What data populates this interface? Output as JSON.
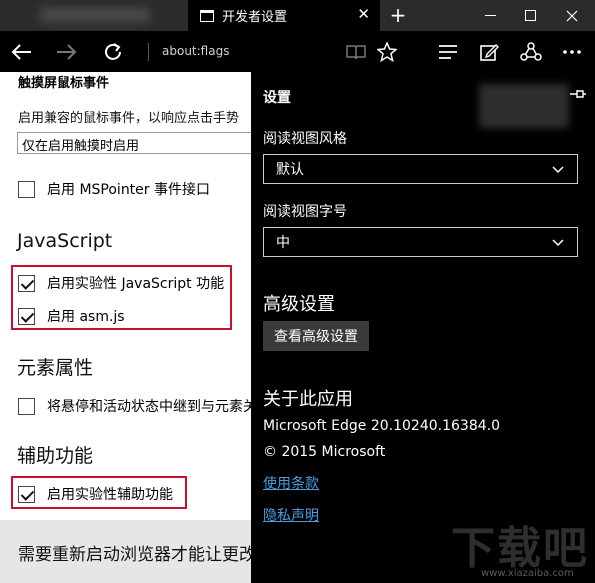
{
  "window": {
    "tab_title": "开发者设置",
    "new_tab_symbol": "+",
    "close_tab_symbol": "✕"
  },
  "toolbar": {
    "address": "about:flags"
  },
  "flags": {
    "cut_heading": "触摸屏鼠标事件",
    "mouse_desc": "启用兼容的鼠标事件，以响应点击手势",
    "mouse_select_value": "仅在启用触摸时启用",
    "mspointer_label": "启用 MSPointer 事件接口",
    "js_heading": "JavaScript",
    "js_experimental_label": "启用实验性 JavaScript 功能",
    "asmjs_label": "启用 asm.js",
    "element_heading": "元素属性",
    "hover_label": "将悬停和活动状态中继到与元素关联",
    "a11y_heading": "辅助功能",
    "a11y_label": "启用实验性辅助功能",
    "restart_text": "需要重新启动浏览器才能让更改生效"
  },
  "settings": {
    "title": "设置",
    "reading_style_label": "阅读视图风格",
    "reading_style_value": "默认",
    "reading_font_label": "阅读视图字号",
    "reading_font_value": "中",
    "advanced_heading": "高级设置",
    "advanced_button": "查看高级设置",
    "about_heading": "关于此应用",
    "version": "Microsoft Edge 20.10240.16384.0",
    "copyright": "© 2015 Microsoft",
    "terms_link": "使用条款",
    "privacy_link": "隐私声明"
  },
  "watermark": {
    "logo": "下载吧",
    "url": "www.xiazaiba.com"
  },
  "colors": {
    "highlight_border": "#c8102e",
    "link": "#4a9ee0",
    "pane_background": "#000000"
  }
}
